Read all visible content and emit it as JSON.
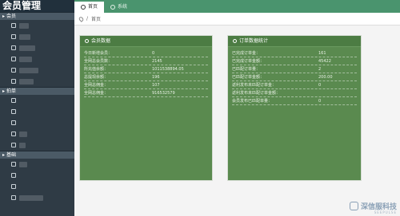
{
  "app": {
    "title": "会员管理"
  },
  "tabs": [
    {
      "label": "首页",
      "active": true
    },
    {
      "label": "系统",
      "active": false
    }
  ],
  "breadcrumb": {
    "current": "首页"
  },
  "sidebar": {
    "groups": [
      {
        "label": "会员",
        "items": 6
      },
      {
        "label": "拍单",
        "items": 5
      },
      {
        "label": "基础",
        "items": 4
      }
    ]
  },
  "member_card": {
    "title": "会员数据",
    "rows": [
      {
        "label": "今日新增会员：",
        "value": "0"
      },
      {
        "label": "全网总会员数：",
        "value": "2145"
      },
      {
        "label": "所充值余额：",
        "value": "1011538894.05"
      },
      {
        "label": "总提现余额：",
        "value": "196"
      },
      {
        "label": "全网总佣金：",
        "value": "107"
      },
      {
        "label": "全网总佣金：",
        "value": "916532579"
      }
    ]
  },
  "order_card": {
    "title": "订单数据统计",
    "rows": [
      {
        "label": "已完成订单金：",
        "value": "161"
      },
      {
        "label": "已完成订单金额：",
        "value": "45422"
      },
      {
        "label": "已匹配订单量：",
        "value": "2"
      },
      {
        "label": "已匹配订单金额：",
        "value": "200.00"
      },
      {
        "label": "返利发布未匹配订单金：",
        "value": "0"
      },
      {
        "label": "返利发布未匹配订单金额：",
        "value": ""
      },
      {
        "label": "会员发布已匹配单量：",
        "value": "0"
      }
    ]
  },
  "watermark": {
    "text": "深信服科技",
    "sub": "SEEPULSE"
  },
  "colors": {
    "topbar": "#4a946e",
    "sidebar": "#2f3b45",
    "card": "#5a8a4f"
  }
}
